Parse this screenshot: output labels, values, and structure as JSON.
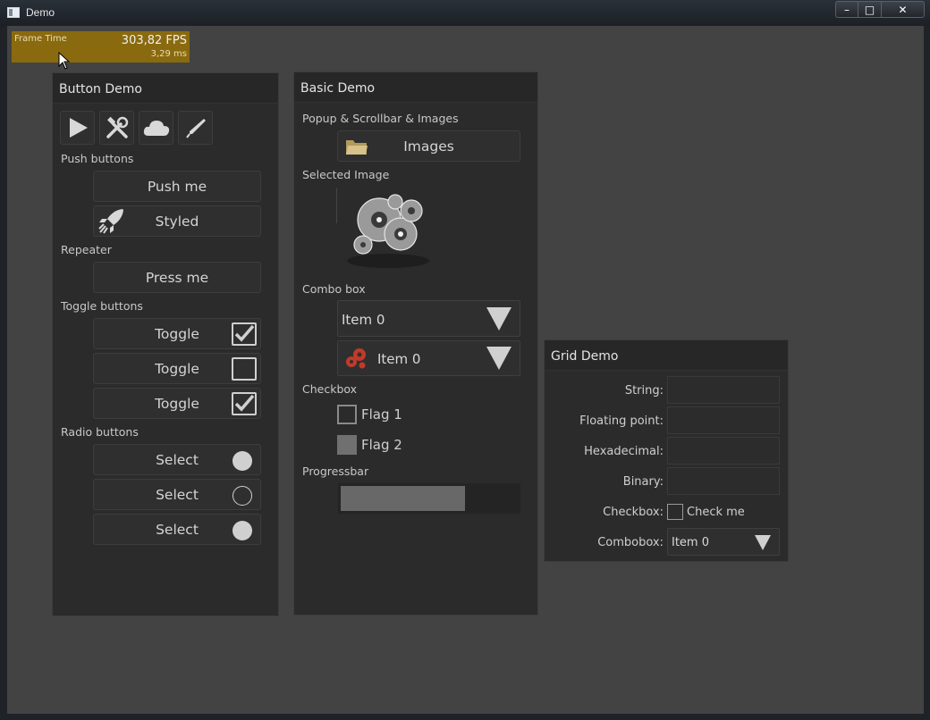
{
  "window": {
    "title": "Demo",
    "controls": {
      "minimize": "–",
      "maximize": "□",
      "close": "✕"
    }
  },
  "fps_overlay": {
    "label": "Frame Time",
    "fps": "303,82 FPS",
    "ms": "3,29 ms",
    "color": "#8a6a0e"
  },
  "button_demo": {
    "title": "Button Demo",
    "icon_buttons": [
      "play-icon",
      "tools-icon",
      "cloud-icon",
      "pen-icon"
    ],
    "push_label": "Push buttons",
    "push_me": "Push me",
    "styled": "Styled",
    "repeater_label": "Repeater",
    "press_me": "Press me",
    "toggle_label": "Toggle buttons",
    "toggles": [
      {
        "label": "Toggle",
        "checked": true
      },
      {
        "label": "Toggle",
        "checked": false
      },
      {
        "label": "Toggle",
        "checked": true
      }
    ],
    "radio_label": "Radio buttons",
    "radios": [
      {
        "label": "Select",
        "selected": true
      },
      {
        "label": "Select",
        "selected": false
      },
      {
        "label": "Select",
        "selected": true
      }
    ]
  },
  "basic_demo": {
    "title": "Basic Demo",
    "popup_label": "Popup & Scrollbar & Images",
    "images_button": "Images",
    "selected_image_label": "Selected Image",
    "combo_label": "Combo box",
    "combo1_value": "Item 0",
    "combo2_value": "Item 0",
    "checkbox_label": "Checkbox",
    "flag1": "Flag 1",
    "flag2": "Flag 2",
    "progress_label": "Progressbar",
    "progress_fraction": 0.7
  },
  "grid_demo": {
    "title": "Grid Demo",
    "rows": {
      "string": "String:",
      "floating": "Floating point:",
      "hex": "Hexadecimal:",
      "binary": "Binary:",
      "checkbox": "Checkbox:",
      "combobox": "Combobox:"
    },
    "check_me": "Check me",
    "combobox_value": "Item 0"
  }
}
